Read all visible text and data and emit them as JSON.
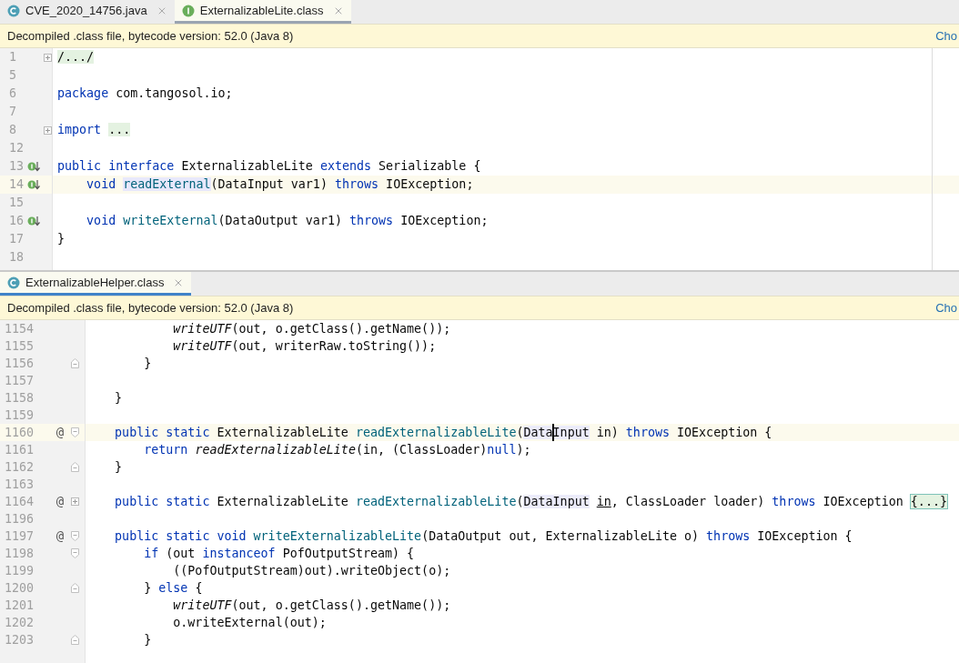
{
  "panes": [
    {
      "kind": "compact",
      "focused": false,
      "tabs": [
        {
          "label": "CVE_2020_14756.java",
          "kind": "class",
          "selected": false
        },
        {
          "label": "ExternalizableLite.class",
          "kind": "interface",
          "selected": true
        }
      ],
      "banner": {
        "text": "Decompiled .class file, bytecode version: 52.0 (Java 8)",
        "link": "Cho"
      },
      "lines": [
        {
          "number": "1",
          "fold": {
            "kind": "collapsed"
          },
          "segments": [
            {
              "t": "/.../",
              "kind": "folded"
            }
          ]
        },
        {
          "number": "5"
        },
        {
          "number": "6",
          "segments": [
            {
              "t": "package",
              "kind": "kw"
            },
            {
              "t": " com.tangosol.io;",
              "kind": "plain"
            }
          ]
        },
        {
          "number": "7"
        },
        {
          "number": "8",
          "fold": {
            "kind": "collapsed"
          },
          "segments": [
            {
              "t": "import ",
              "kind": "kw"
            },
            {
              "t": "...",
              "kind": "folded"
            }
          ]
        },
        {
          "number": "12"
        },
        {
          "number": "13",
          "marker": {
            "kind": "implemented"
          },
          "segments": [
            {
              "t": "public interface",
              "kind": "kw"
            },
            {
              "t": " ExternalizableLite ",
              "kind": "plain"
            },
            {
              "t": "extends",
              "kind": "kw"
            },
            {
              "t": " Serializable {",
              "kind": "plain"
            }
          ]
        },
        {
          "number": "14",
          "highlighted": true,
          "marker": {
            "kind": "implemented"
          },
          "segments": [
            {
              "t": "    void ",
              "kind": "kw"
            },
            {
              "t": "readExternal",
              "kind": "decl-ref"
            },
            {
              "t": "(DataInput var1) ",
              "kind": "plain"
            },
            {
              "t": "throws",
              "kind": "kw"
            },
            {
              "t": " IOException;",
              "kind": "plain"
            }
          ]
        },
        {
          "number": "15"
        },
        {
          "number": "16",
          "marker": {
            "kind": "implemented"
          },
          "segments": [
            {
              "t": "    void ",
              "kind": "kw"
            },
            {
              "t": "writeExternal",
              "kind": "decl"
            },
            {
              "t": "(DataOutput var1) ",
              "kind": "plain"
            },
            {
              "t": "throws",
              "kind": "kw"
            },
            {
              "t": " IOException;",
              "kind": "plain"
            }
          ]
        },
        {
          "number": "17",
          "segments": [
            {
              "t": "}",
              "kind": "plain"
            }
          ]
        },
        {
          "number": "18"
        }
      ]
    },
    {
      "kind": "wide",
      "focused": true,
      "tabs": [
        {
          "label": "ExternalizableHelper.class",
          "kind": "class",
          "selected": true
        }
      ],
      "banner": {
        "text": "Decompiled .class file, bytecode version: 52.0 (Java 8)",
        "link": "Cho"
      },
      "lines": [
        {
          "number": "1154",
          "segments": [
            {
              "t": "            writeUTF",
              "kind": "call"
            },
            {
              "t": "(out, o.getClass().getName());",
              "kind": "plain"
            }
          ]
        },
        {
          "number": "1155",
          "segments": [
            {
              "t": "            writeUTF",
              "kind": "call"
            },
            {
              "t": "(out, writerRaw.toString());",
              "kind": "plain"
            }
          ]
        },
        {
          "number": "1156",
          "fold": {
            "kind": "end"
          },
          "segments": [
            {
              "t": "        }",
              "kind": "plain"
            }
          ]
        },
        {
          "number": "1157"
        },
        {
          "number": "1158",
          "segments": [
            {
              "t": "    }",
              "kind": "plain"
            }
          ]
        },
        {
          "number": "1159"
        },
        {
          "number": "1160",
          "highlighted": true,
          "marker": {
            "kind": "glyph",
            "text": "@"
          },
          "fold": {
            "kind": "start"
          },
          "segments": [
            {
              "t": "    public static",
              "kind": "kw"
            },
            {
              "t": " ExternalizableLite ",
              "kind": "plain"
            },
            {
              "t": "readExternalizableLite",
              "kind": "decl"
            },
            {
              "t": "(",
              "kind": "plain"
            },
            {
              "t": "Data",
              "kind": "ref",
              "caret_after": true
            },
            {
              "t": "Input",
              "kind": "ref"
            },
            {
              "t": " in) ",
              "kind": "plain"
            },
            {
              "t": "throws",
              "kind": "kw"
            },
            {
              "t": " IOException {",
              "kind": "plain"
            }
          ]
        },
        {
          "number": "1161",
          "segments": [
            {
              "t": "        return ",
              "kind": "kw"
            },
            {
              "t": "readExternalizableLite",
              "kind": "call"
            },
            {
              "t": "(in, (ClassLoader)",
              "kind": "plain"
            },
            {
              "t": "null",
              "kind": "kw"
            },
            {
              "t": ");",
              "kind": "plain"
            }
          ]
        },
        {
          "number": "1162",
          "fold": {
            "kind": "end"
          },
          "segments": [
            {
              "t": "    }",
              "kind": "plain"
            }
          ]
        },
        {
          "number": "1163"
        },
        {
          "number": "1164",
          "marker": {
            "kind": "glyph",
            "text": "@"
          },
          "fold": {
            "kind": "collapsed"
          },
          "segments": [
            {
              "t": "    public static",
              "kind": "kw"
            },
            {
              "t": " ExternalizableLite ",
              "kind": "plain"
            },
            {
              "t": "readExternalizableLite",
              "kind": "decl"
            },
            {
              "t": "(",
              "kind": "plain"
            },
            {
              "t": "DataInput",
              "kind": "ref"
            },
            {
              "t": " in",
              "kind": "underlined"
            },
            {
              "t": ", ClassLoader loader) ",
              "kind": "plain"
            },
            {
              "t": "throws",
              "kind": "kw"
            },
            {
              "t": " IOException ",
              "kind": "plain"
            },
            {
              "t": "{...}",
              "kind": "folded-box"
            }
          ]
        },
        {
          "number": "1196"
        },
        {
          "number": "1197",
          "marker": {
            "kind": "glyph",
            "text": "@"
          },
          "fold": {
            "kind": "start"
          },
          "segments": [
            {
              "t": "    public static void ",
              "kind": "kw"
            },
            {
              "t": "writeExternalizableLite",
              "kind": "decl"
            },
            {
              "t": "(DataOutput out, ExternalizableLite o) ",
              "kind": "plain"
            },
            {
              "t": "throws",
              "kind": "kw"
            },
            {
              "t": " IOException {",
              "kind": "plain"
            }
          ]
        },
        {
          "number": "1198",
          "fold": {
            "kind": "start"
          },
          "segments": [
            {
              "t": "        if",
              "kind": "kw"
            },
            {
              "t": " (out ",
              "kind": "plain"
            },
            {
              "t": "instanceof",
              "kind": "kw"
            },
            {
              "t": " PofOutputStream) {",
              "kind": "plain"
            }
          ]
        },
        {
          "number": "1199",
          "segments": [
            {
              "t": "            ((PofOutputStream)out).writeObject(o);",
              "kind": "plain"
            }
          ]
        },
        {
          "number": "1200",
          "fold": {
            "kind": "end"
          },
          "segments": [
            {
              "t": "        } ",
              "kind": "plain"
            },
            {
              "t": "else",
              "kind": "kw"
            },
            {
              "t": " {",
              "kind": "plain"
            }
          ]
        },
        {
          "number": "1201",
          "segments": [
            {
              "t": "            writeUTF",
              "kind": "call"
            },
            {
              "t": "(out, o.getClass().getName());",
              "kind": "plain"
            }
          ]
        },
        {
          "number": "1202",
          "segments": [
            {
              "t": "            o.writeExternal(out);",
              "kind": "plain"
            }
          ]
        },
        {
          "number": "1203",
          "fold": {
            "kind": "end"
          },
          "segments": [
            {
              "t": "        }",
              "kind": "plain"
            }
          ]
        }
      ]
    }
  ]
}
